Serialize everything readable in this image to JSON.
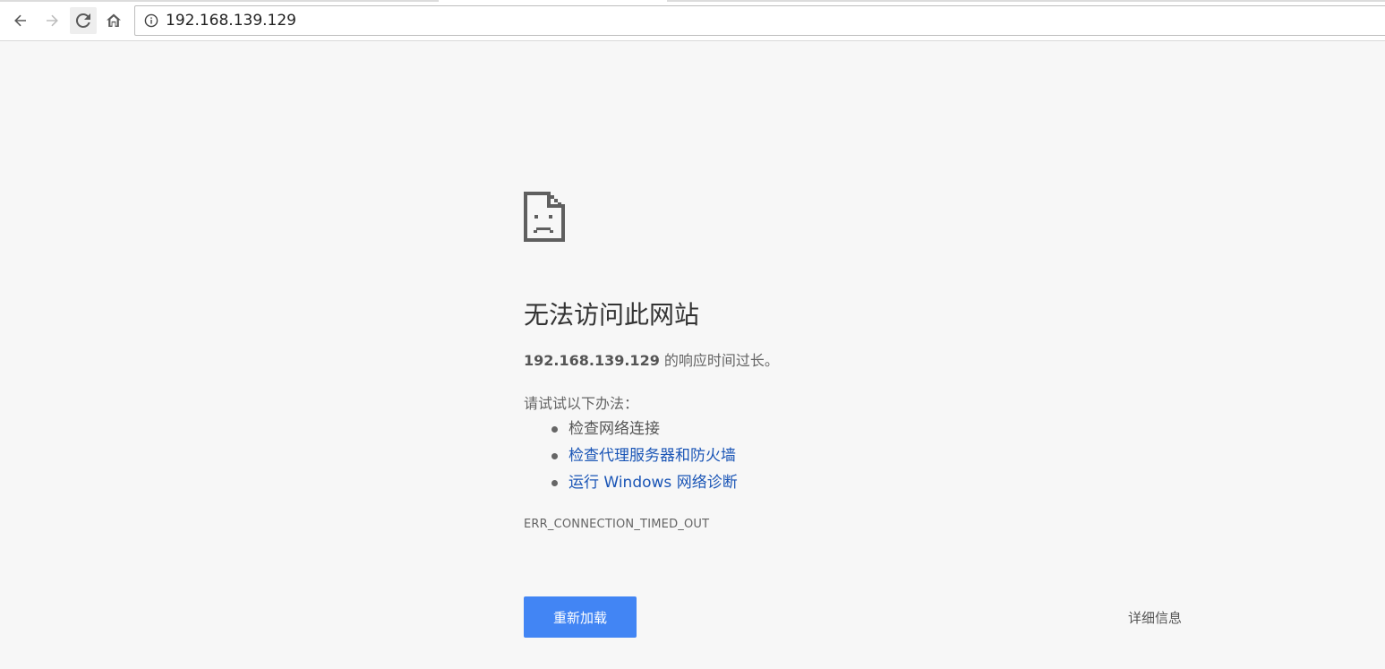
{
  "browser": {
    "url": "192.168.139.129",
    "icons": {
      "back": "arrow-left-icon",
      "forward": "arrow-right-icon",
      "reload": "reload-icon",
      "home": "home-icon",
      "info": "info-icon"
    }
  },
  "error_page": {
    "title": "无法访问此网站",
    "summary_host": "192.168.139.129",
    "summary_text": " 的响应时间过长。",
    "suggestions_header": "请试试以下办法：",
    "suggestions": [
      "检查网络连接",
      "检查代理服务器和防火墙",
      "运行 Windows 网络诊断"
    ],
    "error_code": "ERR_CONNECTION_TIMED_OUT",
    "reload_button": "重新加载",
    "details_button": "详细信息"
  },
  "colors": {
    "background": "#f7f7f7",
    "accent": "#4285f4",
    "link": "#1a55b6"
  }
}
